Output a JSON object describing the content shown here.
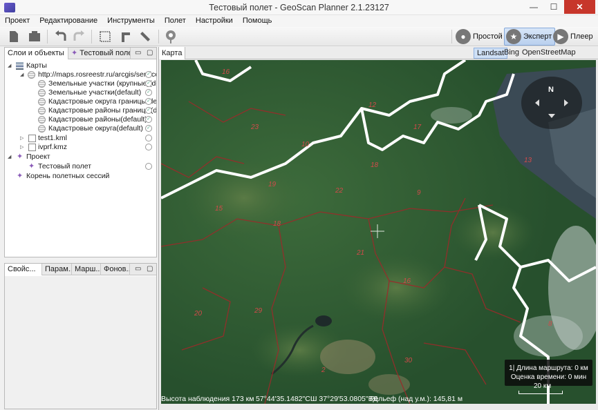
{
  "window": {
    "title": "Тестовый полет - GeoScan Planner 2.1.23127",
    "controls": {
      "minimize": "—",
      "maximize": "☐",
      "close": "✕"
    }
  },
  "menu": [
    "Проект",
    "Редактирование",
    "Инструменты",
    "Полет",
    "Настройки",
    "Помощь"
  ],
  "modes": {
    "simple": "Простой",
    "expert": "Эксперт",
    "player": "Плеер"
  },
  "top_panel": {
    "tabs": [
      {
        "label": "Слои и объекты"
      },
      {
        "label": "Тестовый полет"
      }
    ],
    "tree": {
      "maps": "Карты",
      "server": "http://maps.rosreestr.ru/arcgis/service",
      "layers": [
        "Земельные участки (крупные)(de",
        "Земельные участки(default)",
        "Кадастровые округа границы(def",
        "Кадастровые районы границы(de",
        "Кадастровые районы(default)",
        "Кадастровые округа(default)"
      ],
      "files": [
        "test1.kml",
        "ivprf.kmz"
      ],
      "project": "Проект",
      "flight": "Тестовый полет",
      "sessions_root": "Корень полетных сессий"
    }
  },
  "bottom_panel": {
    "tabs": [
      "Свойс...",
      "Парам...",
      "Марш...",
      "Фонов..."
    ]
  },
  "map": {
    "tab": "Карта",
    "sources": [
      "Landsat",
      "Bing",
      "OpenStreetMap"
    ],
    "selected_source": "Landsat",
    "compass_label": "N",
    "route_length": "1| Длина маршрута: 0 км",
    "time_estimate": "Оценка времени: 0 мин",
    "scale": "20 км",
    "region_numbers": [
      "16",
      "12",
      "23",
      "10",
      "18",
      "17",
      "22",
      "9",
      "13",
      "19",
      "21",
      "15",
      "18",
      "16",
      "8",
      "20",
      "29",
      "2",
      "30"
    ],
    "status": {
      "altitude": "Высота наблюдения 173 км",
      "coords": "57°44'35.1482\"СШ 37°29'53.0805\"ВД",
      "relief": "Рельеф (над у.м.): 145,81 м"
    },
    "colors": {
      "forest": "#2f5a34",
      "boundary_white": "#ffffff",
      "boundary_red": "#9b2a2a"
    }
  }
}
